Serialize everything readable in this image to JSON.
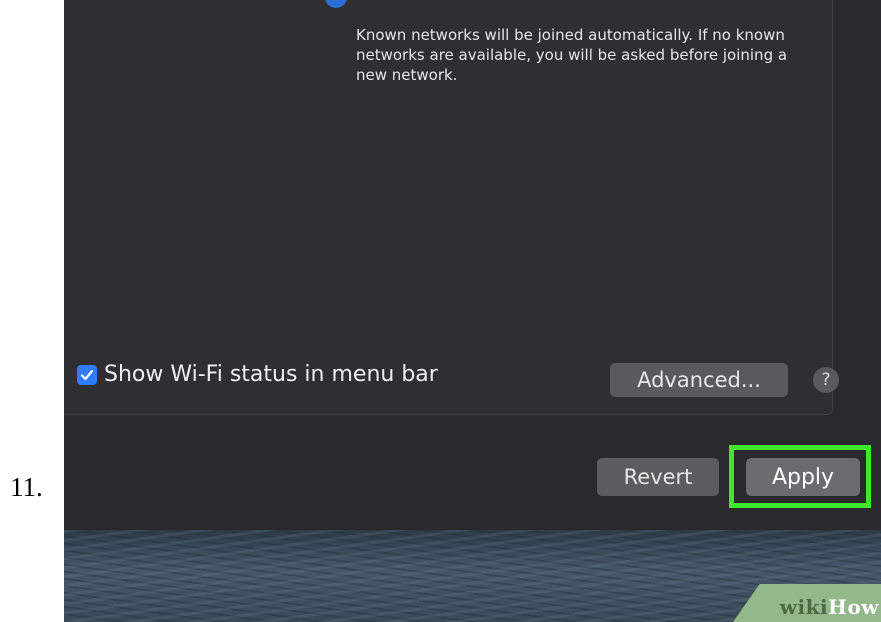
{
  "step_number": "11.",
  "panel": {
    "description": "Known networks will be joined automatically. If no known networks are available, you will be asked before joining a new network.",
    "show_wifi_checkbox": {
      "label": "Show Wi-Fi status in menu bar",
      "checked": true
    },
    "advanced_label": "Advanced...",
    "help_label": "?"
  },
  "footer": {
    "revert_label": "Revert",
    "apply_label": "Apply"
  },
  "highlight_color": "#3ee82a",
  "checkbox_color": "#2f7cf6",
  "watermark": {
    "part1": "wiki",
    "part2": "How"
  }
}
